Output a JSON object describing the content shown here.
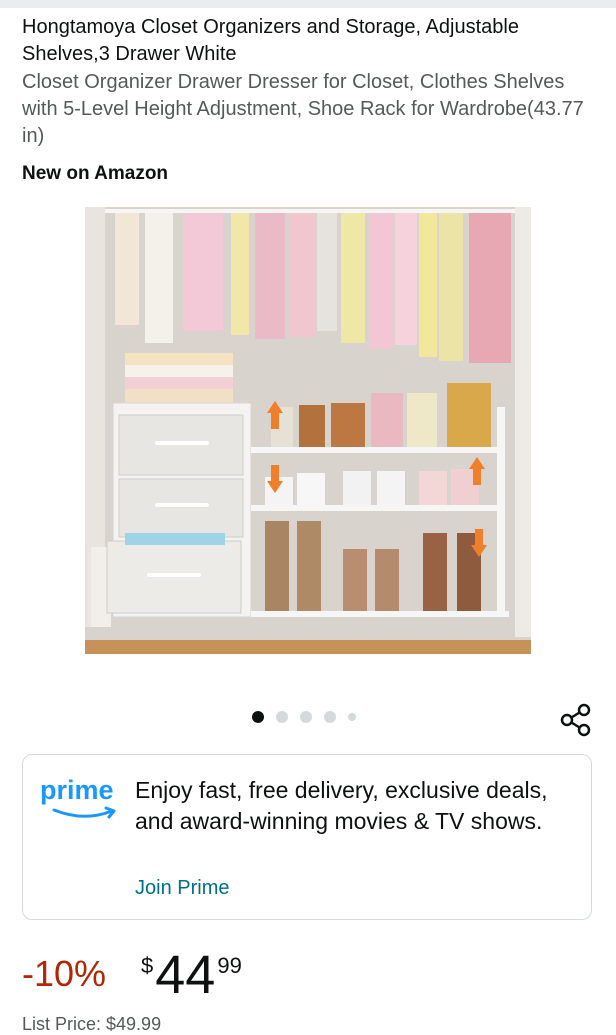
{
  "product": {
    "title": "Hongtamoya Closet Organizers and Storage, Adjustable Shelves,3 Drawer White",
    "subtitle": "Closet Organizer Drawer Dresser for Closet, Clothes Shelves with 5-Level Height Adjustment, Shoe Rack for Wardrobe(43.77 in)",
    "badge": "New on Amazon"
  },
  "carousel": {
    "count": 5,
    "active_index": 0
  },
  "prime": {
    "logo_text": "prime",
    "message": "Enjoy fast, free delivery, exclusive deals, and award-winning movies & TV shows.",
    "join_label": "Join Prime",
    "brand_color": "#1a98ff",
    "link_color": "#007185"
  },
  "pricing": {
    "discount": "-10%",
    "currency": "$",
    "whole": "44",
    "fraction": "99",
    "list_price_label": "List Price: $49.99"
  },
  "colors": {
    "discount": "#b12704"
  },
  "icons": {
    "share": "share-icon",
    "prime_smile": "prime-smile-icon"
  }
}
